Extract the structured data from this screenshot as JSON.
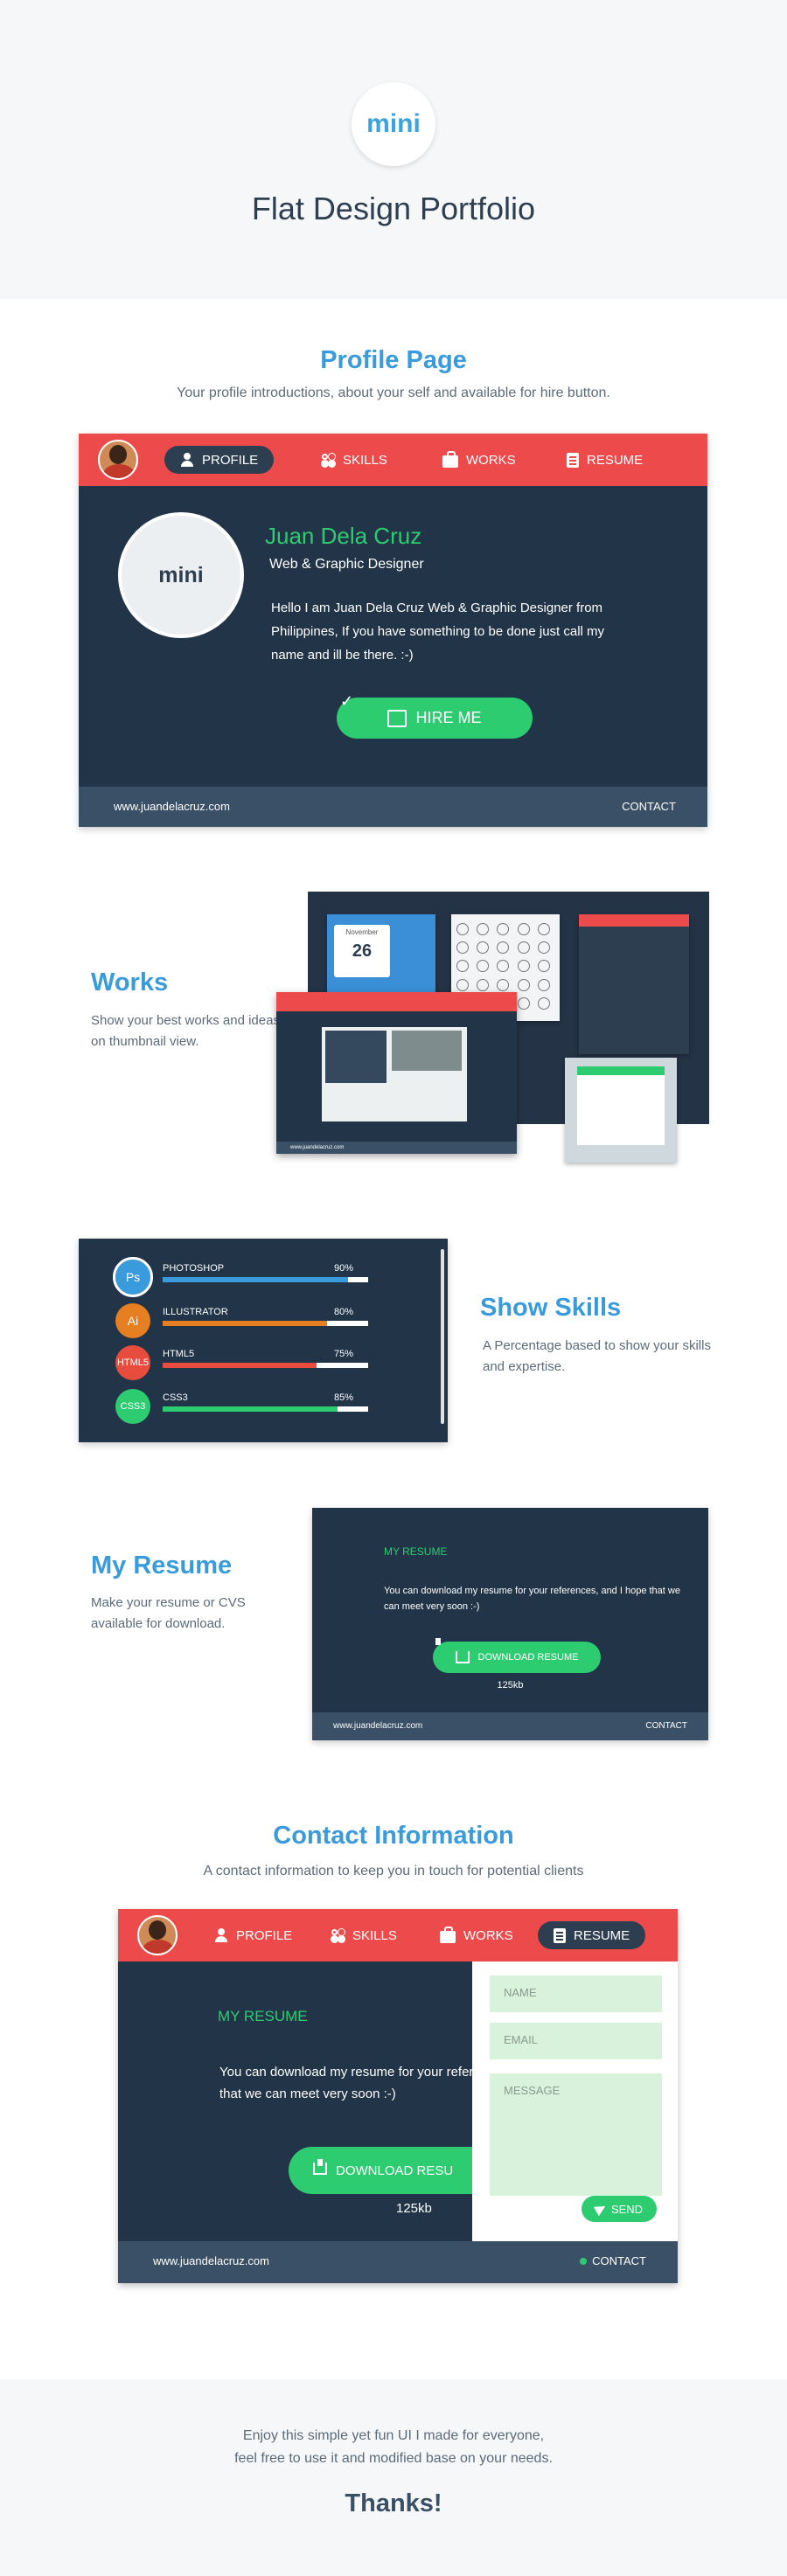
{
  "hero": {
    "logo": "mini",
    "title": "Flat Design Portfolio"
  },
  "nav": {
    "profile": "PROFILE",
    "skills": "SKILLS",
    "works": "WORKS",
    "resume": "RESUME"
  },
  "profile_section": {
    "title": "Profile Page",
    "subtitle": "Your profile introductions, about your self and available for hire button.",
    "pic_text": "mini",
    "name": "Juan Dela Cruz",
    "role": "Web & Graphic Designer",
    "bio": "Hello I am Juan Dela Cruz Web & Graphic Designer from Philippines, If you have something to be done just call my name and ill be there. :-)",
    "hire": "HIRE ME",
    "footer_url": "www.juandelacruz.com",
    "footer_contact": "CONTACT"
  },
  "works_section": {
    "title": "Works",
    "subtitle": "Show your best works and ideas on thumbnail view.",
    "cal_day": "26",
    "cal_month": "November"
  },
  "skills_section": {
    "title": "Show Skills",
    "subtitle": "A Percentage based to show your skills and expertise.",
    "skills": [
      {
        "badge": "Ps",
        "name": "PHOTOSHOP",
        "percent": "90%",
        "value": 0.9,
        "color": "#3a9bdc"
      },
      {
        "badge": "Ai",
        "name": "ILLUSTRATOR",
        "percent": "80%",
        "value": 0.8,
        "color": "#e67e22"
      },
      {
        "badge": "HTML5",
        "name": "HTML5",
        "percent": "75%",
        "value": 0.75,
        "color": "#e74c3c"
      },
      {
        "badge": "CSS3",
        "name": "CSS3",
        "percent": "85%",
        "value": 0.85,
        "color": "#2ecc71"
      }
    ]
  },
  "resume_section": {
    "title": "My Resume",
    "subtitle": "Make your resume or CVS available for download.",
    "card_title": "MY RESUME",
    "card_text": "You can download my resume for your  references, and I hope that we can meet very soon :-)",
    "download": "DOWNLOAD RESUME",
    "size": "125kb",
    "footer_url": "www.juandelacruz.com",
    "footer_contact": "CONTACT"
  },
  "contact_section": {
    "title": "Contact Information",
    "subtitle": "A contact information to keep you in touch for potential clients",
    "card_title": "MY RESUME",
    "card_text_1": "You can download my resume for your refer",
    "card_text_2": "that we can meet very soon :-)",
    "download": "DOWNLOAD RESU",
    "size": "125kb",
    "name_placeholder": "NAME",
    "email_placeholder": "EMAIL",
    "message_placeholder": "MESSAGE",
    "send": "SEND",
    "footer_url": "www.juandelacruz.com",
    "footer_contact": "CONTACT"
  },
  "closing": {
    "line1": "Enjoy this simple yet fun UI I made for everyone,",
    "line2": "feel free to use it and modified base on your needs.",
    "thanks": "Thanks!"
  }
}
